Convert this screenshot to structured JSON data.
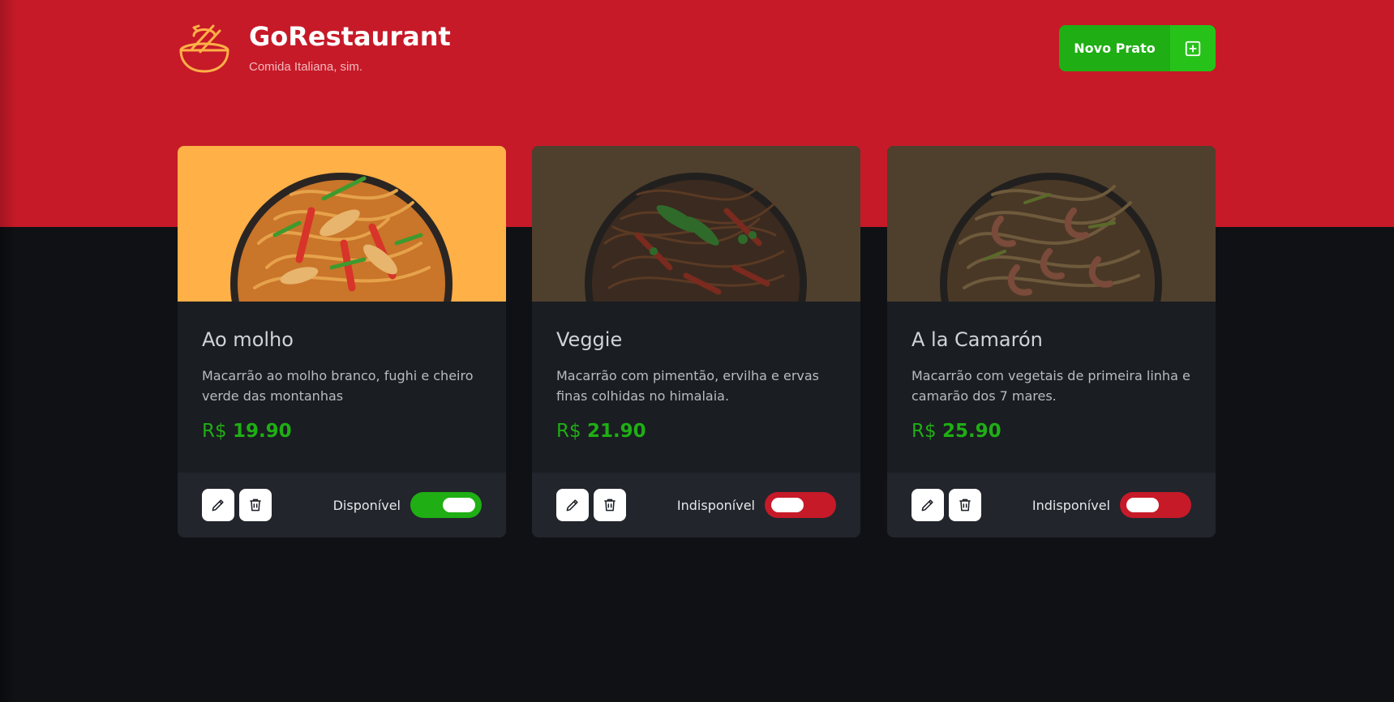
{
  "header": {
    "app_name": "GoRestaurant",
    "tagline": "Comida Italiana, sim.",
    "logo_icon": "bowl-icon",
    "new_button_label": "Novo Prato",
    "new_button_icon": "plus-square-icon"
  },
  "colors": {
    "header_bg": "#c61a28",
    "page_bg": "#0f1115",
    "accent_green": "#1fae14",
    "unavailable_red": "#c61a28",
    "available_media_bg": "#ffb047",
    "unavailable_media_bg": "#4f402d"
  },
  "currency": "R$",
  "foods": [
    {
      "name": "Ao molho",
      "description": "Macarrão ao molho branco, fughi e cheiro verde das montanhas",
      "price": "19.90",
      "status_label": "Disponível",
      "available": true
    },
    {
      "name": "Veggie",
      "description": "Macarrão com pimentão, ervilha e ervas finas colhidas no himalaia.",
      "price": "21.90",
      "status_label": "Indisponível",
      "available": false
    },
    {
      "name": "A la Camarón",
      "description": "Macarrão com vegetais de primeira linha e camarão dos 7 mares.",
      "price": "25.90",
      "status_label": "Indisponível",
      "available": false
    }
  ],
  "actions": {
    "edit_icon": "pencil-icon",
    "delete_icon": "trash-icon"
  }
}
